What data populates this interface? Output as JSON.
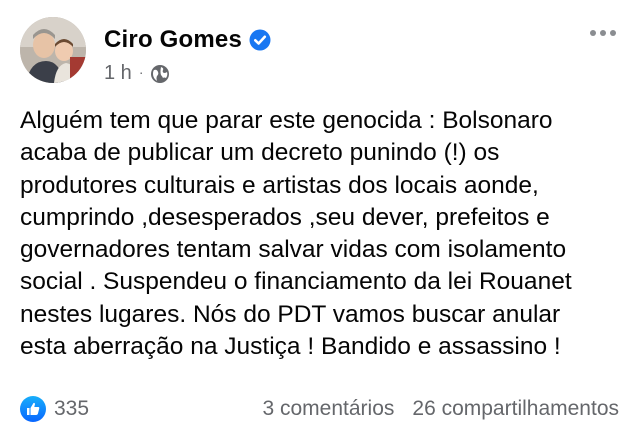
{
  "post": {
    "author": "Ciro Gomes",
    "time": "1 h",
    "text": "Alguém tem que parar este genocida : Bolsonaro\nacaba de publicar um decreto punindo (!) os\nprodutores culturais e artistas dos locais aonde,\ncumprindo ,desesperados ,seu dever, prefeitos e\ngovernadores tentam salvar vidas com isolamento\nsocial . Suspendeu o financiamento da lei Rouanet\nnestes lugares. Nós do PDT vamos buscar anular\nesta aberração na Justiça ! Bandido e assassino !",
    "likes": "335",
    "comments": "3 comentários",
    "shares": "26 compartilhamentos"
  },
  "icons": {
    "verified": "verified-badge-icon",
    "audience": "globe-icon",
    "more": "more-options-icon",
    "reaction": "like-icon"
  },
  "colors": {
    "accent": "#1877f2",
    "secondary_text": "#65676b"
  }
}
